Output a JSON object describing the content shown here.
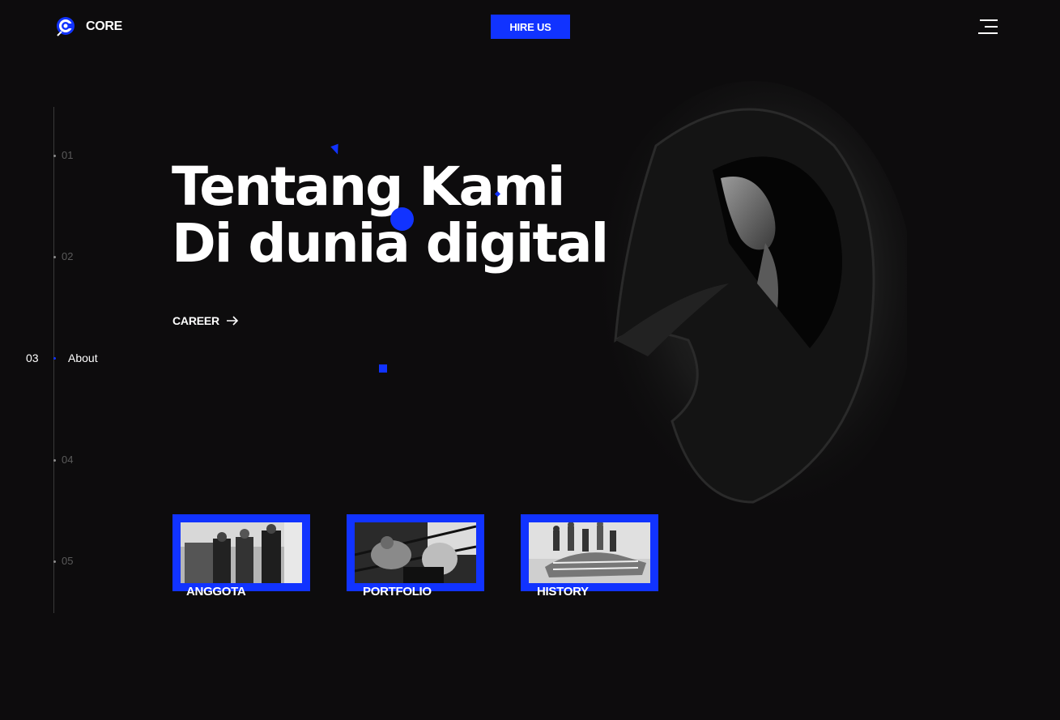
{
  "header": {
    "logo_text": "CORE",
    "hire_label": "HIRE US",
    "accent": "#1133ff"
  },
  "sidenav": {
    "items": [
      {
        "num": "01"
      },
      {
        "num": "02"
      },
      {
        "num": "03",
        "label": "About",
        "active": true
      },
      {
        "num": "04"
      },
      {
        "num": "05"
      }
    ]
  },
  "hero": {
    "title_line1": "Tentang Kami",
    "title_line2": "Di dunia digital",
    "career_label": "CAREER"
  },
  "cards": [
    {
      "label": "ANGGOTA",
      "icon": "street-photo-thumbnail"
    },
    {
      "label": "PORTFOLIO",
      "icon": "boxing-photo-thumbnail"
    },
    {
      "label": "HISTORY",
      "icon": "car-crowd-photo-thumbnail"
    }
  ]
}
